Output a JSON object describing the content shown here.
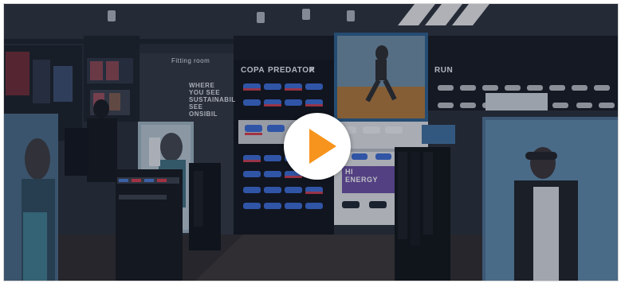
{
  "store": {
    "fitting_room": "Fitting room",
    "sustainability_panel": [
      "WHERE",
      "YOU SEE",
      "SUSTAINABIL",
      "SEE",
      "ONSIBIL"
    ],
    "wall_headers": [
      "COPA",
      "PREDATOR",
      "X"
    ],
    "run_header": "RUN",
    "hi_energy": [
      "HI",
      "ENERGY"
    ]
  },
  "player": {
    "play_icon": "play-icon",
    "accent": "#f7941d"
  },
  "colors": {
    "background": "#1f242c",
    "shelf_blue": "#3b6bd6",
    "shelf_red": "#d93b4b",
    "banner_purple": "#6b4ea3"
  }
}
